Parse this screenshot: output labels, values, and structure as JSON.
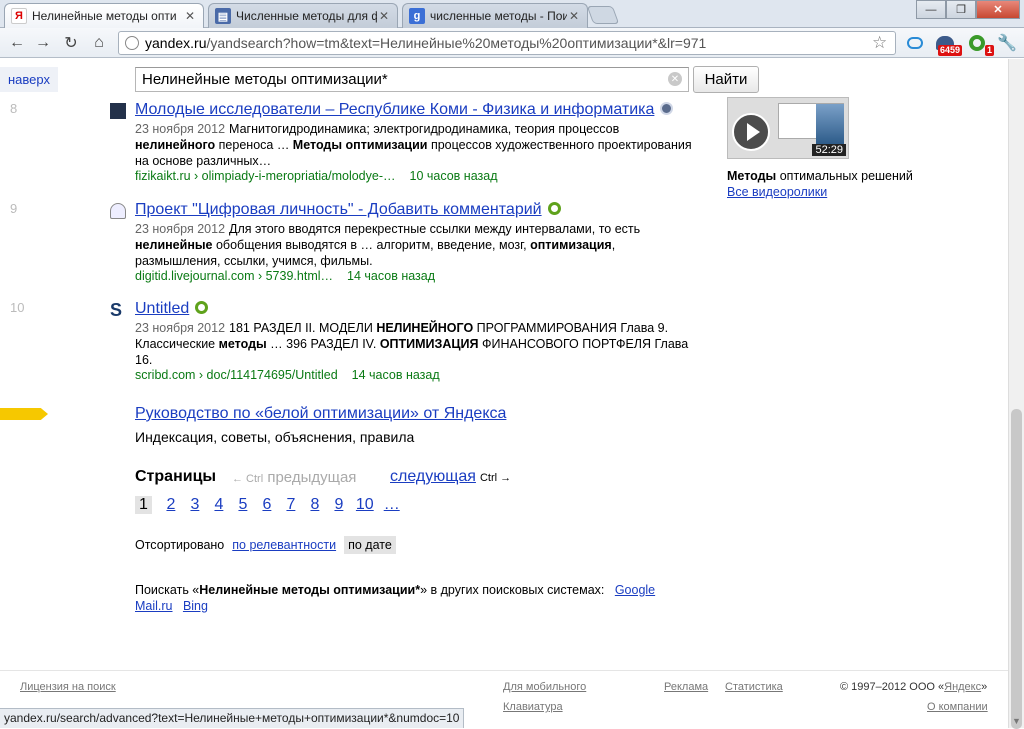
{
  "tabs": [
    {
      "title": "Нелинейные методы опти",
      "favicon": "yandex-icon"
    },
    {
      "title": "Численные методы для ф",
      "favicon": "doc-icon"
    },
    {
      "title": "численные методы - Поис",
      "favicon": "google-icon"
    }
  ],
  "toolbar": {
    "url_host": "yandex.ru",
    "url_path": "/yandsearch?how=tm&text=Нелинейные%20методы%20оптимизации*&lr=971",
    "ext_badge_1": "6459",
    "ext_badge_2": "1",
    "ext_badge_3": "0"
  },
  "search": {
    "top_link": "наверх",
    "query": "Нелинейные методы оптимизации*",
    "button": "Найти"
  },
  "results": [
    {
      "num": "8",
      "title": "Молодые исследователи – Республике Коми - Физика и информатика",
      "date": "23 ноября 2012",
      "snippet_html_parts": [
        "Магнитогидродинамика; электрогидродинамика, теория процессов ",
        "нелинейного",
        " переноса … ",
        "Методы оптимизации",
        " процессов художественного проектирования на основе различных…"
      ],
      "url": "fizikaikt.ru › olimpiady-i-meropriatia/molodye-…",
      "ago": "10 часов назад"
    },
    {
      "num": "9",
      "title": "Проект \"Цифровая личность\" - Добавить комментарий",
      "date": "23 ноября 2012",
      "snippet_html_parts": [
        "Для этого вводятся перекрестные ссылки между интервалами, то есть ",
        "нелинейные",
        " обобщения выводятся в … алгоритм, введение, мозг, ",
        "оптимизация",
        ", размышления, ссылки, учимся, фильмы."
      ],
      "url": "digitid.livejournal.com › 5739.html…",
      "ago": "14 часов назад"
    },
    {
      "num": "10",
      "title": "Untitled",
      "date": "23 ноября 2012",
      "snippet_html_parts": [
        "181 РАЗДЕЛ II. МОДЕЛИ ",
        "НЕЛИНЕЙНОГО",
        " ПРОГРАММИРОВАНИЯ Глава 9. Классические ",
        "методы",
        " … 396 РАЗДЕЛ IV. ",
        "ОПТИМИЗАЦИЯ",
        " ФИНАНСОВОГО ПОРТФЕЛЯ Глава 16."
      ],
      "url": "scribd.com › doc/114174695/Untitled",
      "ago": "14 часов назад"
    }
  ],
  "video": {
    "duration": "52:29",
    "caption_bold": "Методы",
    "caption_rest": " оптимальных решений",
    "all_link": "Все видеоролики"
  },
  "promo": {
    "title": "Руководство по «белой оптимизации» от Яндекса",
    "desc": "Индексация, советы, объяснения, правила"
  },
  "pager": {
    "label": "Страницы",
    "prev_hint": "← Ctrl",
    "prev": "предыдущая",
    "next": "следующая",
    "next_hint": "Ctrl →",
    "pages": [
      "1",
      "2",
      "3",
      "4",
      "5",
      "6",
      "7",
      "8",
      "9",
      "10",
      "…"
    ]
  },
  "sort": {
    "label": "Отсортировано",
    "by_relevance": "по релевантности",
    "by_date": "по дате"
  },
  "other_engines": {
    "prefix": "Поискать «",
    "query": "Нелинейные методы оптимизации*",
    "suffix": "» в других поисковых системах:",
    "links": [
      "Google",
      "Mail.ru",
      "Bing"
    ]
  },
  "footer": {
    "license": "Лицензия на поиск",
    "mobile": "Для мобильного",
    "keyboard": "Клавиатура",
    "ads": "Реклама",
    "stats": "Статистика",
    "copyright_prefix": "© 1997–2012  ООО «",
    "copyright_link": "Яндекс",
    "copyright_suffix": "»",
    "about": "О компании"
  },
  "status_url": "yandex.ru/search/advanced?text=Нелинейные+методы+оптимизации*&numdoc=10"
}
